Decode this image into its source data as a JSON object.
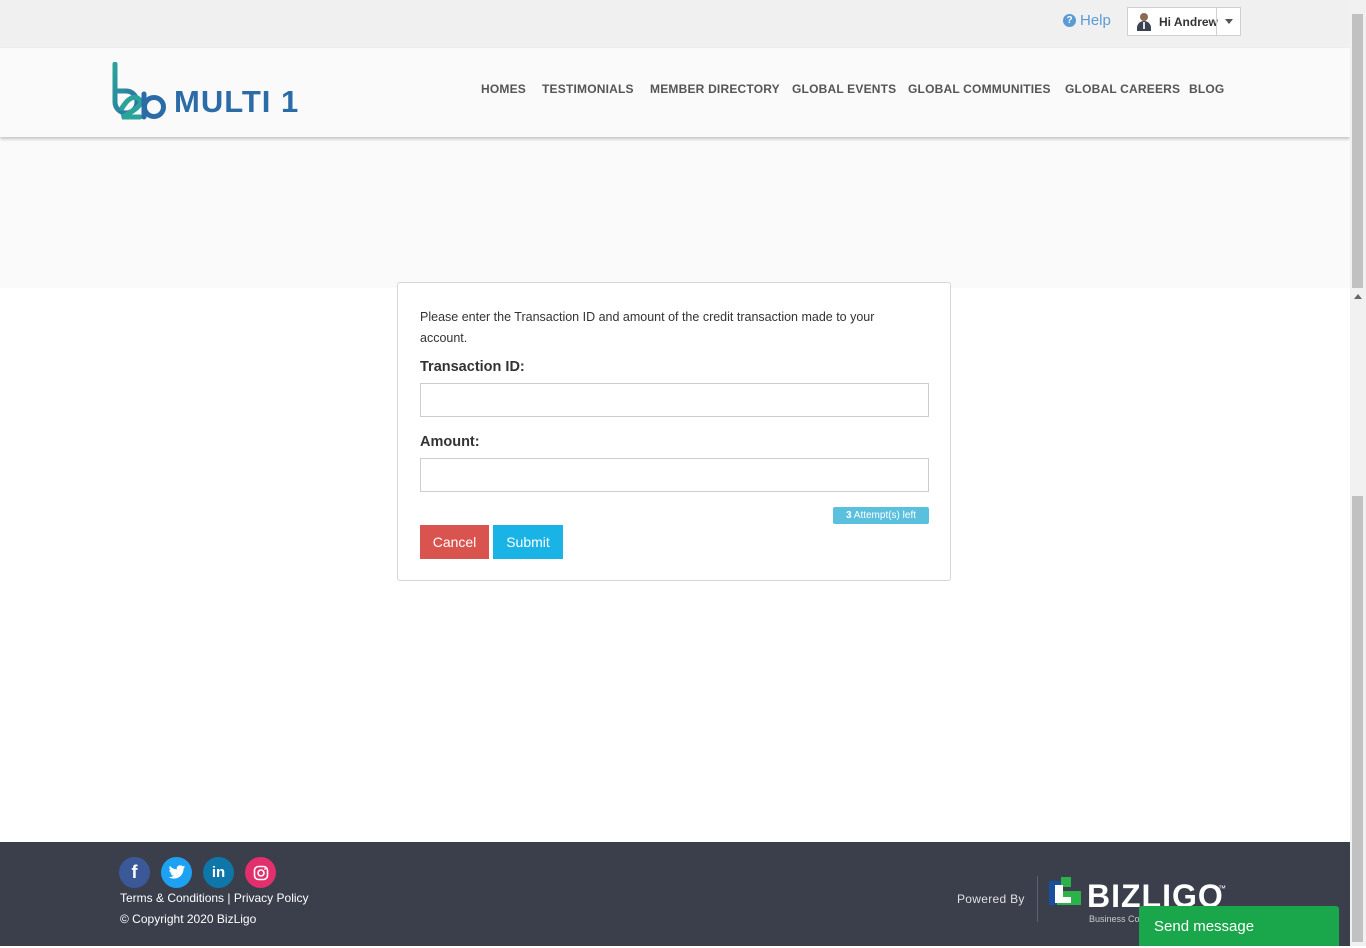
{
  "topbar": {
    "help_label": "Help",
    "help_icon": "?",
    "user_greeting": "Hi Andrew"
  },
  "header": {
    "logo_text": "MULTI 1",
    "nav": [
      {
        "label": "HOMES"
      },
      {
        "label": "TESTIMONIALS"
      },
      {
        "label": "MEMBER DIRECTORY"
      },
      {
        "label": "GLOBAL EVENTS"
      },
      {
        "label": "GLOBAL COMMUNITIES"
      },
      {
        "label": "GLOBAL CAREERS"
      },
      {
        "label": "BLOG"
      }
    ]
  },
  "form": {
    "intro": "Please enter the Transaction ID and amount of the credit transaction made to your account.",
    "transaction_label": "Transaction ID:",
    "transaction_value": "",
    "amount_label": "Amount:",
    "amount_value": "",
    "attempts_count": "3",
    "attempts_text": " Attempt(s) left",
    "cancel_label": "Cancel",
    "submit_label": "Submit"
  },
  "footer": {
    "social": [
      "facebook-icon",
      "twitter-icon",
      "linkedin-icon",
      "instagram-icon"
    ],
    "terms_label": "Terms & Conditions",
    "separator": " | ",
    "privacy_label": "Privacy Policy",
    "copyright": "© Copyright 2020 BizLigo",
    "powered_by": "Powered By",
    "brand_name": "BIZLIGO",
    "brand_tm": "™",
    "brand_sub": "Business Co"
  },
  "chat": {
    "send_message_label": "Send message"
  },
  "colors": {
    "accent": "#1ab3e6",
    "danger": "#d9534f",
    "info_badge": "#5bc0de",
    "footer_bg": "#3a3f4b",
    "chat_green": "#1aa64a"
  }
}
